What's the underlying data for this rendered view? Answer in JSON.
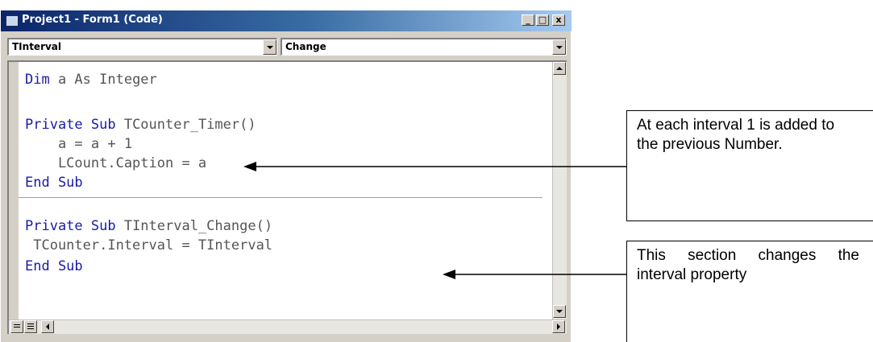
{
  "window": {
    "title": "Project1 - Form1 (Code)",
    "controls": {
      "minimize": "_",
      "maximize": "□",
      "close": "x"
    }
  },
  "object_combo": {
    "value": "TInterval"
  },
  "procedure_combo": {
    "value": "Change"
  },
  "code": {
    "l1_kw": "Dim",
    "l1_rest": " a As Integer",
    "l2_kw": "Private Sub",
    "l2_rest": " TCounter_Timer()",
    "l3": "    a = a + 1",
    "l4": "    LCount.Caption = a",
    "l5_kw": "End Sub",
    "l6_kw": "Private Sub",
    "l6_rest": " TInterval_Change()",
    "l7": " TCounter.Interval = TInterval",
    "l8_kw": "End Sub"
  },
  "callouts": {
    "first": "At each interval 1 is added to the previous Number.",
    "second": "This section changes the interval property"
  },
  "icons": [
    "window-icon",
    "dropdown-arrow-icon",
    "scroll-up-icon",
    "scroll-down-icon",
    "scroll-left-icon",
    "scroll-right-icon",
    "procedure-view-icon",
    "full-module-view-icon"
  ]
}
